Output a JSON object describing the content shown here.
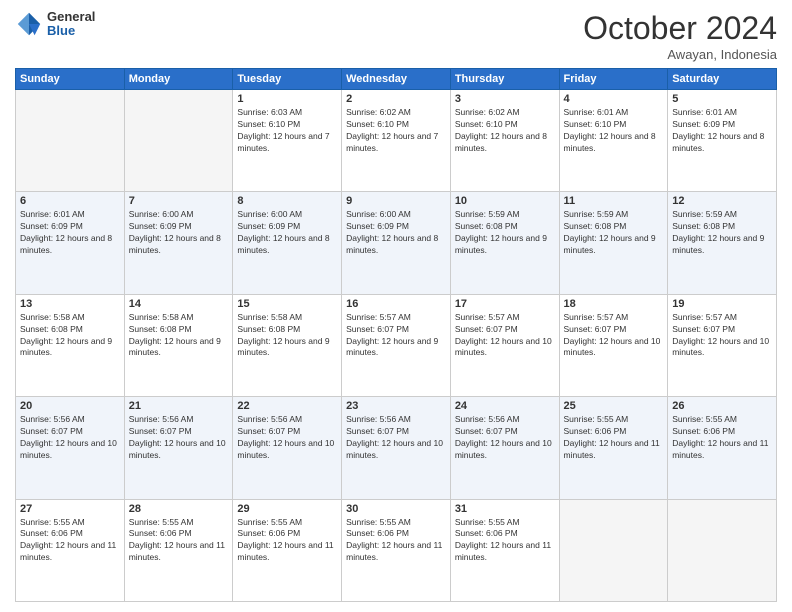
{
  "header": {
    "logo": {
      "general": "General",
      "blue": "Blue"
    },
    "title": "October 2024",
    "location": "Awayan, Indonesia"
  },
  "days_of_week": [
    "Sunday",
    "Monday",
    "Tuesday",
    "Wednesday",
    "Thursday",
    "Friday",
    "Saturday"
  ],
  "weeks": [
    [
      {
        "day": "",
        "info": ""
      },
      {
        "day": "",
        "info": ""
      },
      {
        "day": "1",
        "info": "Sunrise: 6:03 AM\nSunset: 6:10 PM\nDaylight: 12 hours and 7 minutes."
      },
      {
        "day": "2",
        "info": "Sunrise: 6:02 AM\nSunset: 6:10 PM\nDaylight: 12 hours and 7 minutes."
      },
      {
        "day": "3",
        "info": "Sunrise: 6:02 AM\nSunset: 6:10 PM\nDaylight: 12 hours and 8 minutes."
      },
      {
        "day": "4",
        "info": "Sunrise: 6:01 AM\nSunset: 6:10 PM\nDaylight: 12 hours and 8 minutes."
      },
      {
        "day": "5",
        "info": "Sunrise: 6:01 AM\nSunset: 6:09 PM\nDaylight: 12 hours and 8 minutes."
      }
    ],
    [
      {
        "day": "6",
        "info": "Sunrise: 6:01 AM\nSunset: 6:09 PM\nDaylight: 12 hours and 8 minutes."
      },
      {
        "day": "7",
        "info": "Sunrise: 6:00 AM\nSunset: 6:09 PM\nDaylight: 12 hours and 8 minutes."
      },
      {
        "day": "8",
        "info": "Sunrise: 6:00 AM\nSunset: 6:09 PM\nDaylight: 12 hours and 8 minutes."
      },
      {
        "day": "9",
        "info": "Sunrise: 6:00 AM\nSunset: 6:09 PM\nDaylight: 12 hours and 8 minutes."
      },
      {
        "day": "10",
        "info": "Sunrise: 5:59 AM\nSunset: 6:08 PM\nDaylight: 12 hours and 9 minutes."
      },
      {
        "day": "11",
        "info": "Sunrise: 5:59 AM\nSunset: 6:08 PM\nDaylight: 12 hours and 9 minutes."
      },
      {
        "day": "12",
        "info": "Sunrise: 5:59 AM\nSunset: 6:08 PM\nDaylight: 12 hours and 9 minutes."
      }
    ],
    [
      {
        "day": "13",
        "info": "Sunrise: 5:58 AM\nSunset: 6:08 PM\nDaylight: 12 hours and 9 minutes."
      },
      {
        "day": "14",
        "info": "Sunrise: 5:58 AM\nSunset: 6:08 PM\nDaylight: 12 hours and 9 minutes."
      },
      {
        "day": "15",
        "info": "Sunrise: 5:58 AM\nSunset: 6:08 PM\nDaylight: 12 hours and 9 minutes."
      },
      {
        "day": "16",
        "info": "Sunrise: 5:57 AM\nSunset: 6:07 PM\nDaylight: 12 hours and 9 minutes."
      },
      {
        "day": "17",
        "info": "Sunrise: 5:57 AM\nSunset: 6:07 PM\nDaylight: 12 hours and 10 minutes."
      },
      {
        "day": "18",
        "info": "Sunrise: 5:57 AM\nSunset: 6:07 PM\nDaylight: 12 hours and 10 minutes."
      },
      {
        "day": "19",
        "info": "Sunrise: 5:57 AM\nSunset: 6:07 PM\nDaylight: 12 hours and 10 minutes."
      }
    ],
    [
      {
        "day": "20",
        "info": "Sunrise: 5:56 AM\nSunset: 6:07 PM\nDaylight: 12 hours and 10 minutes."
      },
      {
        "day": "21",
        "info": "Sunrise: 5:56 AM\nSunset: 6:07 PM\nDaylight: 12 hours and 10 minutes."
      },
      {
        "day": "22",
        "info": "Sunrise: 5:56 AM\nSunset: 6:07 PM\nDaylight: 12 hours and 10 minutes."
      },
      {
        "day": "23",
        "info": "Sunrise: 5:56 AM\nSunset: 6:07 PM\nDaylight: 12 hours and 10 minutes."
      },
      {
        "day": "24",
        "info": "Sunrise: 5:56 AM\nSunset: 6:07 PM\nDaylight: 12 hours and 10 minutes."
      },
      {
        "day": "25",
        "info": "Sunrise: 5:55 AM\nSunset: 6:06 PM\nDaylight: 12 hours and 11 minutes."
      },
      {
        "day": "26",
        "info": "Sunrise: 5:55 AM\nSunset: 6:06 PM\nDaylight: 12 hours and 11 minutes."
      }
    ],
    [
      {
        "day": "27",
        "info": "Sunrise: 5:55 AM\nSunset: 6:06 PM\nDaylight: 12 hours and 11 minutes."
      },
      {
        "day": "28",
        "info": "Sunrise: 5:55 AM\nSunset: 6:06 PM\nDaylight: 12 hours and 11 minutes."
      },
      {
        "day": "29",
        "info": "Sunrise: 5:55 AM\nSunset: 6:06 PM\nDaylight: 12 hours and 11 minutes."
      },
      {
        "day": "30",
        "info": "Sunrise: 5:55 AM\nSunset: 6:06 PM\nDaylight: 12 hours and 11 minutes."
      },
      {
        "day": "31",
        "info": "Sunrise: 5:55 AM\nSunset: 6:06 PM\nDaylight: 12 hours and 11 minutes."
      },
      {
        "day": "",
        "info": ""
      },
      {
        "day": "",
        "info": ""
      }
    ]
  ]
}
